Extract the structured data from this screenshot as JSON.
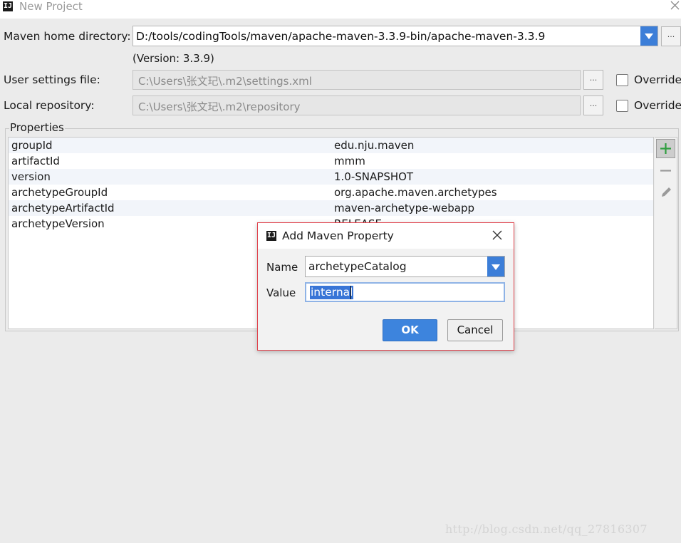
{
  "window": {
    "title": "New Project",
    "app_icon": "IJ"
  },
  "maven": {
    "home_label": "Maven home directory:",
    "home_value": "D:/tools/codingTools/maven/apache-maven-3.3.9-bin/apache-maven-3.3.9",
    "version_text": "(Version: 3.3.9)",
    "settings_label": "User settings file:",
    "settings_value": "C:\\Users\\张文玘\\.m2\\settings.xml",
    "repo_label": "Local repository:",
    "repo_value": "C:\\Users\\张文玘\\.m2\\repository",
    "browse_label": "...",
    "override_label": "Override"
  },
  "properties": {
    "legend": "Properties",
    "rows": [
      {
        "name": "groupId",
        "value": "edu.nju.maven"
      },
      {
        "name": "artifactId",
        "value": "mmm"
      },
      {
        "name": "version",
        "value": "1.0-SNAPSHOT"
      },
      {
        "name": "archetypeGroupId",
        "value": "org.apache.maven.archetypes"
      },
      {
        "name": "archetypeArtifactId",
        "value": "maven-archetype-webapp"
      },
      {
        "name": "archetypeVersion",
        "value": "RELEASE"
      }
    ]
  },
  "dialog": {
    "title": "Add Maven Property",
    "name_label": "Name",
    "name_value": "archetypeCatalog",
    "value_label": "Value",
    "value_value": "internal",
    "ok_label": "OK",
    "cancel_label": "Cancel"
  },
  "watermark": "http://blog.csdn.net/qq_27816307",
  "colors": {
    "accent": "#3c7ed8",
    "dialog_border": "#e0424c",
    "add_icon": "#2f9e3f"
  }
}
